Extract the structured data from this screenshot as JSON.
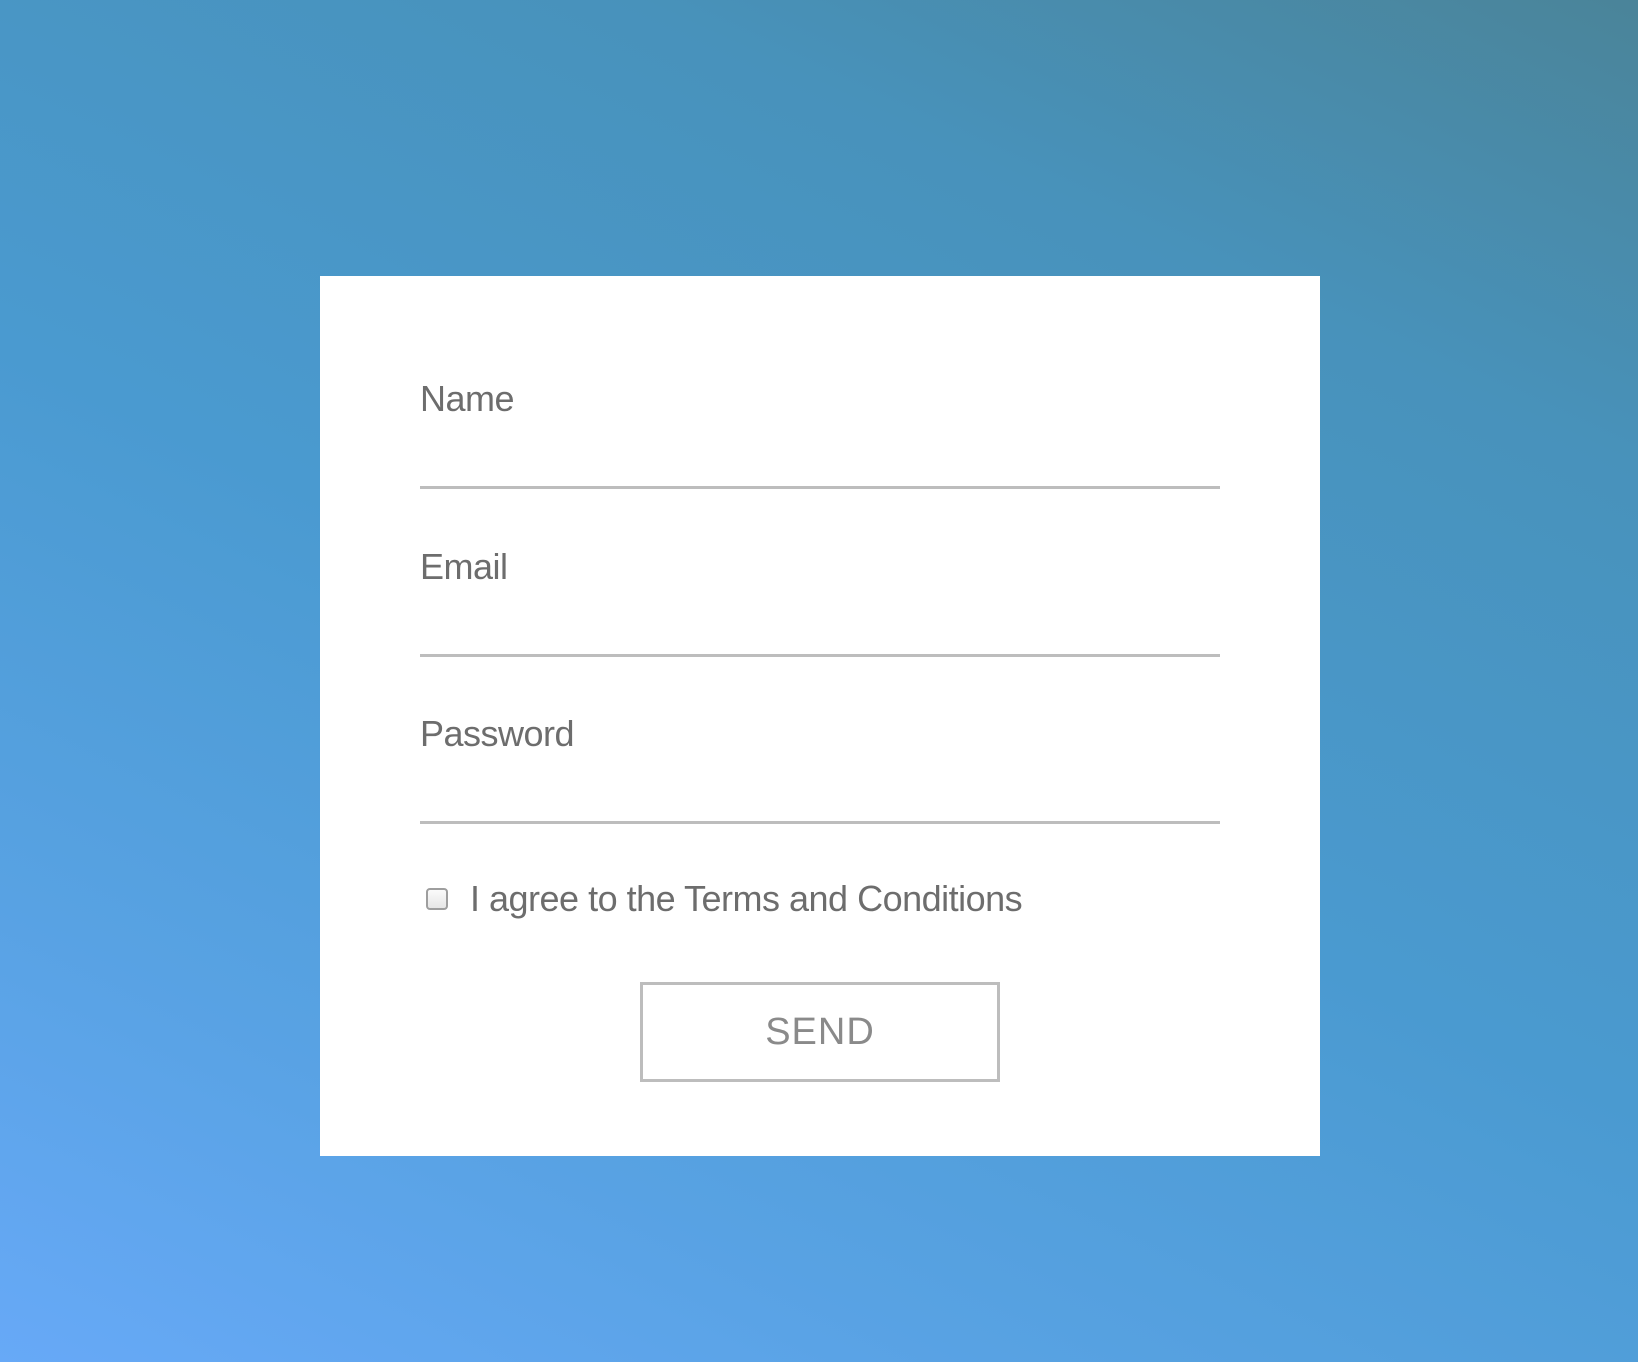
{
  "background": {
    "gradient_colors": [
      "#67a9f7",
      "#58a2e3",
      "#4a9ad0",
      "#4892bb",
      "#4a8499"
    ]
  },
  "form": {
    "fields": [
      {
        "label": "Name",
        "value": "",
        "placeholder": ""
      },
      {
        "label": "Email",
        "value": "",
        "placeholder": ""
      },
      {
        "label": "Password",
        "value": "",
        "placeholder": ""
      }
    ],
    "terms": {
      "label": "I agree to the Terms and Conditions",
      "checked": false
    },
    "submit_label": "SEND"
  },
  "colors": {
    "card": "#ffffff",
    "text": "#6d6d6d",
    "underline": "#bdbdbd",
    "button_text": "#8a8a8a"
  }
}
